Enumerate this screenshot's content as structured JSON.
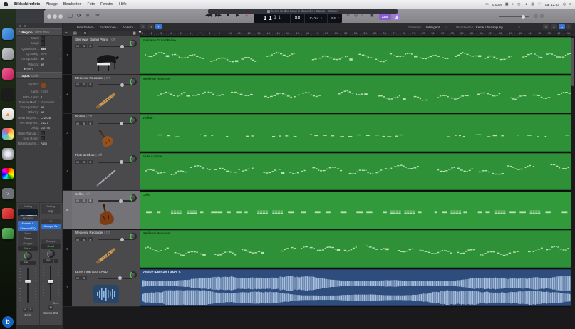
{
  "menubar": {
    "app_items": [
      "Bildschirmfoto",
      "Ablage",
      "Bearbeiten",
      "Foto",
      "Fenster",
      "Hilfe"
    ],
    "status_meter": "0.00M",
    "clock": "Sa. 12:53",
    "status_icons": [
      "display-mirroring-icon",
      "updown-arrows-icon",
      "clock-icon",
      "volume-icon",
      "keyboard-icon",
      "heart-icon"
    ],
    "status_icons_right": [
      "search-icon",
      "menu-list-icon"
    ]
  },
  "window_title": "kennt ihr das Land in deutschen Gauen – Spuren",
  "control_bar": {
    "lcd": {
      "bar": "1",
      "beat": "1",
      "div": "1",
      "tick": "1",
      "tempo": "88",
      "key": "C-Dur",
      "time_sig": "4/4"
    },
    "count_in_badge": "1234",
    "left_icons": [
      "library-icon",
      "cycle-arrows-icon",
      "mixer-icon",
      "scissors-icon"
    ],
    "right_icons": [
      "cycle-loop-icon",
      "replace-icon",
      "pencil-icon",
      "count-in-icon"
    ]
  },
  "edit_bar": {
    "menus": [
      "Bearbeiten",
      "Funktionen",
      "Ansicht"
    ],
    "marquee_tool": "H",
    "snap_label": "Einrasten:",
    "snap_value": "Intelligent",
    "drag_label": "Verschieben:",
    "drag_value": "Keine Überlappung"
  },
  "ruler_bars": 45,
  "inspector": {
    "region_label": "Region:",
    "region_value": "MIDI Thru",
    "region_rows": [
      {
        "label": "Mute:",
        "value": "",
        "check": true
      },
      {
        "label": "Loop:",
        "value": "",
        "check": true
      },
      {
        "label": "Quantisier...:",
        "value": "aus",
        "strong": true,
        "stepper": true
      },
      {
        "label": "Q-Swing:",
        "value": "50%",
        "dim": true
      },
      {
        "label": "Transposition:",
        "value": "±0",
        "stepper": true
      },
      {
        "label": "Velocity:",
        "value": "±0"
      },
      {
        "label": "Mehr",
        "value": "",
        "more": true
      }
    ],
    "track_label": "Spur:",
    "track_value": "Cello",
    "track_rows": [
      {
        "label": "Symbol:",
        "value": "",
        "symbol": true
      },
      {
        "label": "Kanal:",
        "value": "Inst 5",
        "dim": true
      },
      {
        "label": "MIDI-Kanal:",
        "value": "1",
        "stepper": true
      },
      {
        "label": "Freeze-Mod...:",
        "value": "Pre-Fader",
        "dim": true
      },
      {
        "label": "Transposition:",
        "value": "±0",
        "stepper": true
      },
      {
        "label": "Velocity:",
        "value": "±0"
      },
      {
        "label": "Notenbegren...:",
        "value": "C-2  G8"
      },
      {
        "label": "Vel.-Begrenz.:",
        "value": "0  127"
      },
      {
        "label": "Delay:",
        "value": "0,0 ms"
      },
      {
        "label": "Ohne Transp...:",
        "value": "",
        "check": true
      },
      {
        "label": "Kein Reset:",
        "value": "",
        "check": true
      },
      {
        "label": "Notensystem...:",
        "value": "Auto",
        "stepper": true
      }
    ]
  },
  "strips": [
    {
      "name": "Cello",
      "setting": "Setting",
      "rows": [
        {
          "t": "",
          "k": "eq"
        },
        {
          "t": "MIDI-FX",
          "k": "dim"
        },
        {
          "t": "Kontakt 5",
          "k": "blue"
        },
        {
          "t": "Channel EQ",
          "k": "blue"
        },
        {
          "t": "Send",
          "k": "dim"
        },
        {
          "t": "Stereo",
          "k": "btn"
        },
        {
          "t": "Gruppe",
          "k": "dim"
        },
        {
          "t": "Read",
          "k": "green"
        }
      ],
      "value": "-6.8",
      "pan": "green",
      "bounce": "",
      "buttons": [
        "M",
        "S"
      ]
    },
    {
      "name": "Stereo Out",
      "setting": "Setting",
      "rows": [
        {
          "t": "EQ",
          "k": "btn"
        },
        {
          "t": "",
          "k": "blank"
        },
        {
          "t": "St",
          "k": "dim"
        },
        {
          "t": "iZotope Oz",
          "k": "blue"
        },
        {
          "t": "",
          "k": "blank"
        },
        {
          "t": "",
          "k": "blank"
        },
        {
          "t": "Gruppe",
          "k": "dim"
        },
        {
          "t": "Read",
          "k": "green"
        }
      ],
      "value": "0.0",
      "pan": "plain",
      "bounce": "Bnce",
      "buttons": [
        "M"
      ]
    }
  ],
  "track_toolbar": {
    "add": "+",
    "solo": "S"
  },
  "tracks": [
    {
      "num": "1",
      "name": "Steinway Grand Piano",
      "state": "Off",
      "buttons": [
        "M",
        "S",
        "R"
      ],
      "icon": "piano",
      "type": "midi",
      "region_name": "Steinway Grand Piano",
      "pattern": "melodic",
      "vol": 0.72
    },
    {
      "num": "2",
      "name": "Medieval Recorder",
      "state": "Off",
      "buttons": [
        "M",
        "S",
        "R"
      ],
      "icon": "recorder",
      "type": "midi",
      "region_name": "Medieval Recorder",
      "pattern": "melodic",
      "vol": 0.72
    },
    {
      "num": "3",
      "name": "Violine",
      "state": "Off",
      "buttons": [
        "M",
        "S",
        "R"
      ],
      "icon": "violin",
      "type": "midi",
      "region_name": "Violine",
      "pattern": "sparse",
      "vol": 0.7
    },
    {
      "num": "4",
      "name": "Flute & Oboe",
      "state": "Off",
      "buttons": [
        "M",
        "S",
        "R"
      ],
      "icon": "flute",
      "type": "midi",
      "region_name": "Flute & Oboe",
      "pattern": "melodic2",
      "vol": 0.7
    },
    {
      "num": "5",
      "name": "Cello",
      "state": "Off",
      "buttons": [
        "M",
        "S",
        "R"
      ],
      "icon": "cello",
      "type": "midi",
      "region_name": "Cello",
      "pattern": "cello",
      "vol": 0.68,
      "selected": true,
      "record": true
    },
    {
      "num": "6",
      "name": "Medieval Recorder",
      "state": "Off",
      "buttons": [
        "M",
        "S",
        "R"
      ],
      "icon": "recorder",
      "type": "midi",
      "region_name": "Medieval Recorder",
      "pattern": "melodic",
      "vol": 0.72
    },
    {
      "num": "7",
      "name": "KENNT IHR DAS LAND",
      "state": "",
      "buttons": [
        "M",
        "S"
      ],
      "icon": "audio",
      "type": "audio",
      "region_name": "KENNT IHR DAS LAND",
      "pattern": "audio",
      "vol": 0.66
    }
  ],
  "colors": {
    "region_green": "#2e9137",
    "region_name_green": "#0a4211",
    "note_light": "#c2e5bd",
    "audio_bg": "#2e4d7c",
    "audio_wave": "#b6cde9",
    "accent_blue": "#3577d8",
    "purple": "#8a5ad0",
    "lcd_orange": "#bf7c2c",
    "record_red": "#d2382d"
  }
}
